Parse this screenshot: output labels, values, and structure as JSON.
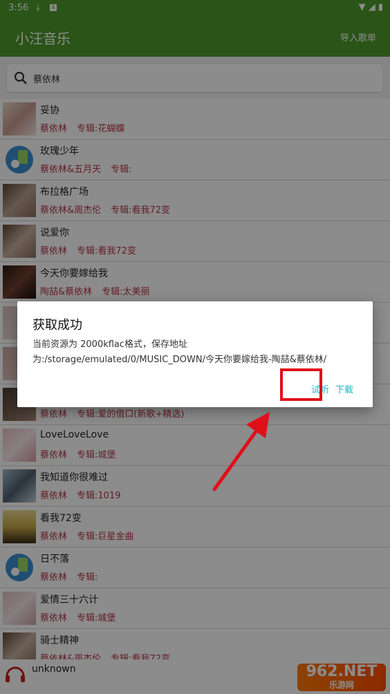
{
  "status_bar": {
    "time": "3:56",
    "download_icon": "download-icon",
    "a_icon": "A"
  },
  "app": {
    "title": "小汪音乐",
    "import": "导入歌单"
  },
  "search": {
    "value": "蔡依林"
  },
  "songs": [
    {
      "title": "妥协",
      "artist": "蔡依林",
      "album": "专辑:花蝴蝶"
    },
    {
      "title": "玫瑰少年",
      "artist": "蔡依林&五月天",
      "album": "专辑:"
    },
    {
      "title": "布拉格广场",
      "artist": "蔡依林&周杰伦",
      "album": "专辑:看我72变"
    },
    {
      "title": "说爱你",
      "artist": "蔡依林",
      "album": "专辑:看我72变"
    },
    {
      "title": "今天你要嫁给我",
      "artist": "陶喆&蔡依林",
      "album": "专辑:太美丽"
    },
    {
      "title": "",
      "artist": "",
      "album": ""
    },
    {
      "title": "",
      "artist": "",
      "album": ""
    },
    {
      "title": "",
      "artist": "蔡依林",
      "album": "专辑:爱的借口(新歌+精选)"
    },
    {
      "title": "LoveLoveLove",
      "artist": "蔡依林",
      "album": "专辑:城堡"
    },
    {
      "title": "我知道你很难过",
      "artist": "蔡依林",
      "album": "专辑:1019"
    },
    {
      "title": "看我72变",
      "artist": "蔡依林",
      "album": "专辑:巨星金曲"
    },
    {
      "title": "日不落",
      "artist": "蔡依林",
      "album": "专辑:"
    },
    {
      "title": "爱情三十六计",
      "artist": "蔡依林",
      "album": "专辑:城堡"
    },
    {
      "title": "骑士精神",
      "artist": "蔡依林&周杰伦",
      "album": "专辑:看我72变"
    }
  ],
  "player": {
    "track": "unknown"
  },
  "dialog": {
    "title": "获取成功",
    "message": "当前资源为 2000kflac格式，保存地址为:/storage/emulated/0/MUSIC_DOWN/今天你要嫁给我-陶喆&蔡依林/",
    "listen": "试听",
    "download": "下载"
  },
  "watermark": {
    "main": "962.NET",
    "sub": "乐游网"
  },
  "colors": {
    "primary": "#4f9a2c",
    "accent": "#19b6c7",
    "artist_text": "#b33545",
    "highlight": "#e0101a"
  }
}
